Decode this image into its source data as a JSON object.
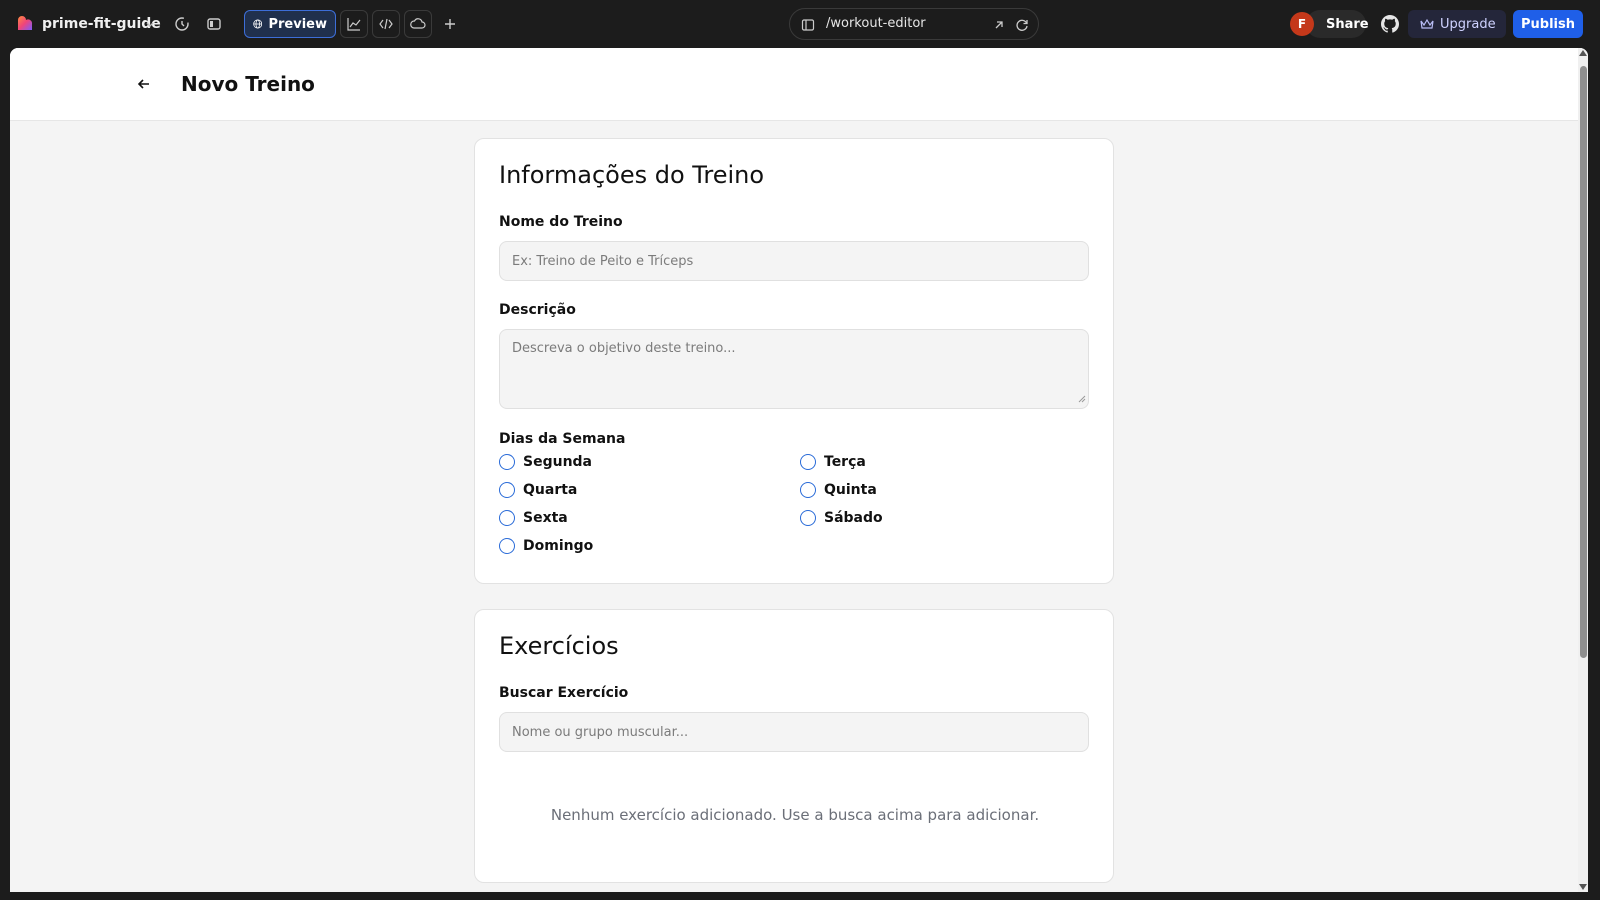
{
  "topbar": {
    "project_name": "prime-fit-guide",
    "preview_label": "Preview",
    "url_path": "/workout-editor",
    "avatar_initial": "F",
    "share_label": "Share",
    "upgrade_label": "Upgrade",
    "publish_label": "Publish",
    "accent_color": "#1f5fe8"
  },
  "app": {
    "page_title": "Novo Treino"
  },
  "info_card": {
    "title": "Informações do Treino",
    "name_label": "Nome do Treino",
    "name_placeholder": "Ex: Treino de Peito e Tríceps",
    "name_value": "",
    "description_label": "Descrição",
    "description_placeholder": "Descreva o objetivo deste treino...",
    "description_value": "",
    "days_label": "Dias da Semana",
    "days": [
      {
        "label": "Segunda",
        "checked": false
      },
      {
        "label": "Terça",
        "checked": false
      },
      {
        "label": "Quarta",
        "checked": false
      },
      {
        "label": "Quinta",
        "checked": false
      },
      {
        "label": "Sexta",
        "checked": false
      },
      {
        "label": "Sábado",
        "checked": false
      },
      {
        "label": "Domingo",
        "checked": false
      }
    ]
  },
  "exercises_card": {
    "title": "Exercícios",
    "search_label": "Buscar Exercício",
    "search_placeholder": "Nome ou grupo muscular...",
    "search_value": "",
    "empty_message": "Nenhum exercício adicionado. Use a busca acima para adicionar."
  }
}
